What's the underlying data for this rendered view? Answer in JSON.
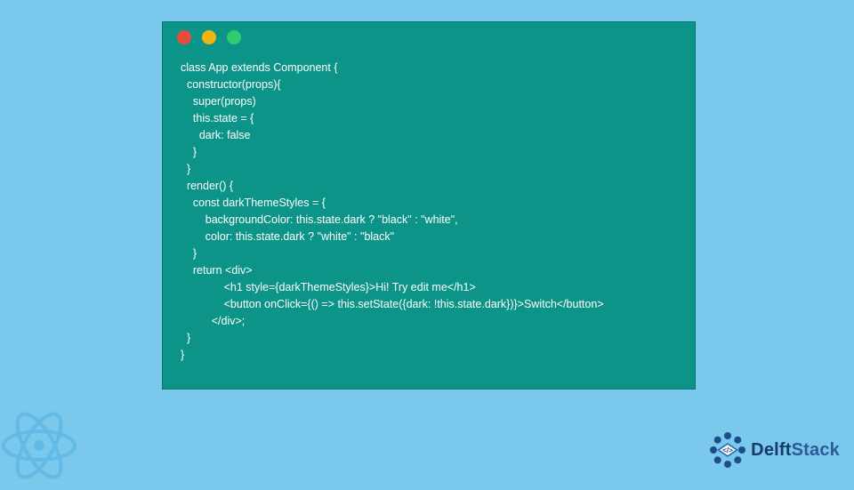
{
  "window": {
    "dots": [
      "red",
      "yellow",
      "green"
    ]
  },
  "code": {
    "lines": [
      "class App extends Component {",
      "  constructor(props){",
      "    super(props)",
      "    this.state = {",
      "      dark: false",
      "    }",
      "  }",
      "  render() {",
      "    const darkThemeStyles = {",
      "        backgroundColor: this.state.dark ? \"black\" : \"white\",",
      "        color: this.state.dark ? \"white\" : \"black\"",
      "    }",
      "    return <div>",
      "              <h1 style={darkThemeStyles}>Hi! Try edit me</h1>",
      "              <button onClick={() => this.setState({dark: !this.state.dark})}>Switch</button>",
      "          </div>;",
      "  }",
      "}"
    ]
  },
  "brand": {
    "name_part1": "Delft",
    "name_part2": "Stack"
  }
}
